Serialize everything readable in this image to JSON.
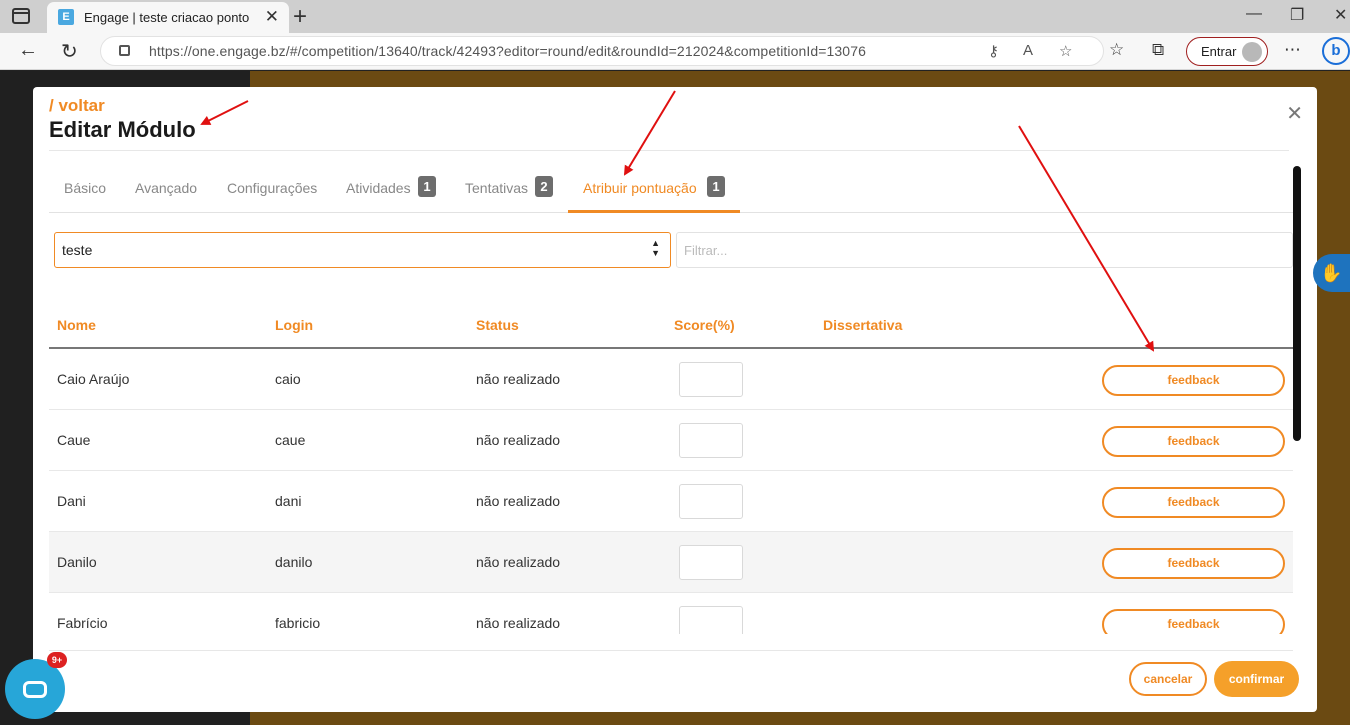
{
  "browser": {
    "tab_title": "Engage | teste criacao ponto",
    "favicon_letter": "E",
    "url": "https://one.engage.bz/#/competition/13640/track/42493?editor=round/edit&roundId=212024&competitionId=13076",
    "signin_label": "Entrar",
    "bing_label": "b"
  },
  "modal": {
    "back_link": "/ voltar",
    "title": "Editar Módulo",
    "tabs": [
      {
        "label": "Básico"
      },
      {
        "label": "Avançado"
      },
      {
        "label": "Configurações"
      },
      {
        "label": "Atividades",
        "badge": "1"
      },
      {
        "label": "Tentativas",
        "badge": "2"
      },
      {
        "label": "Atribuir pontuação",
        "badge": "1"
      }
    ],
    "select_value": "teste",
    "filter_placeholder": "Filtrar...",
    "table": {
      "headers": [
        "Nome",
        "Login",
        "Status",
        "Score(%)",
        "Dissertativa"
      ],
      "rows": [
        {
          "name": "Caio Araújo",
          "login": "caio",
          "status": "não realizado",
          "feedback": "feedback"
        },
        {
          "name": "Caue",
          "login": "caue",
          "status": "não realizado",
          "feedback": "feedback"
        },
        {
          "name": "Dani",
          "login": "dani",
          "status": "não realizado",
          "feedback": "feedback"
        },
        {
          "name": "Danilo",
          "login": "danilo",
          "status": "não realizado",
          "feedback": "feedback"
        },
        {
          "name": "Fabrício",
          "login": "fabricio",
          "status": "não realizado",
          "feedback": "feedback"
        }
      ]
    },
    "cancel_label": "cancelar",
    "confirm_label": "confirmar"
  },
  "chat_badge": "9+",
  "colors": {
    "accent": "#f08a24",
    "annotation_arrow": "#e01010"
  },
  "icons": {
    "close": "close-icon",
    "a11y": "sign-language-icon",
    "chat": "chat-icon"
  }
}
